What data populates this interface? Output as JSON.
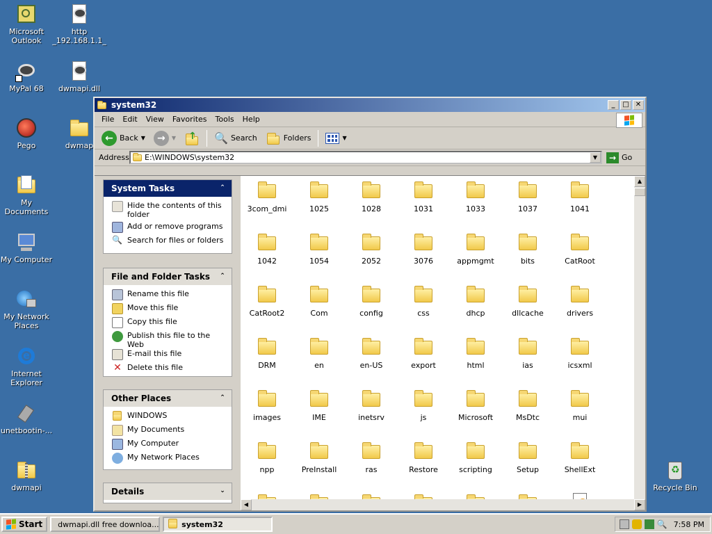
{
  "desktop": {
    "icons": [
      {
        "label": "Microsoft Outlook",
        "icon": "outlook-icon"
      },
      {
        "label": "http _192.168.1.1_",
        "icon": "raccoon-doc-icon"
      },
      {
        "label": "MyPal 68",
        "icon": "raccoon-shortcut-icon"
      },
      {
        "label": "dwmapi.dll",
        "icon": "raccoon-doc-icon"
      },
      {
        "label": "Pego",
        "icon": "red-orb-icon"
      },
      {
        "label": "dwmap",
        "icon": "folder-icon"
      },
      {
        "label": "My Documents",
        "icon": "my-documents-icon"
      },
      {
        "label": "My Computer",
        "icon": "my-computer-icon"
      },
      {
        "label": "My Network Places",
        "icon": "network-places-icon"
      },
      {
        "label": "Internet Explorer",
        "icon": "internet-explorer-icon"
      },
      {
        "label": "unetbootin-...",
        "icon": "unetbootin-icon"
      },
      {
        "label": "dwmapi",
        "icon": "zip-folder-icon"
      },
      {
        "label": "dwmap",
        "icon": "dll-gear-icon"
      },
      {
        "label": "Recycle Bin",
        "icon": "recycle-bin-icon"
      }
    ]
  },
  "window": {
    "title": "system32",
    "menu": [
      "File",
      "Edit",
      "View",
      "Favorites",
      "Tools",
      "Help"
    ],
    "toolbar": {
      "back": "Back",
      "search": "Search",
      "folders": "Folders"
    },
    "address": {
      "label": "Address",
      "value": "E:\\WINDOWS\\system32",
      "go": "Go"
    }
  },
  "tasks": {
    "system": {
      "title": "System Tasks",
      "items": [
        "Hide the contents of this folder",
        "Add or remove programs",
        "Search for files or folders"
      ]
    },
    "file_folder": {
      "title": "File and Folder Tasks",
      "items": [
        "Rename this file",
        "Move this file",
        "Copy this file",
        "Publish this file to the Web",
        "E-mail this file",
        "Delete this file"
      ]
    },
    "other_places": {
      "title": "Other Places",
      "items": [
        "WINDOWS",
        "My Documents",
        "My Computer",
        "My Network Places"
      ]
    },
    "details": {
      "title": "Details"
    }
  },
  "folders": [
    "3com_dmi",
    "1025",
    "1028",
    "1031",
    "1033",
    "1037",
    "1041",
    "1042",
    "1054",
    "2052",
    "3076",
    "appmgmt",
    "bits",
    "CatRoot",
    "CatRoot2",
    "Com",
    "config",
    "css",
    "dhcp",
    "dllcache",
    "drivers",
    "DRM",
    "en",
    "en-US",
    "export",
    "html",
    "ias",
    "icsxml",
    "images",
    "IME",
    "inetsrv",
    "js",
    "Microsoft",
    "MsDtc",
    "mui",
    "npp",
    "PreInstall",
    "ras",
    "Restore",
    "scripting",
    "Setup",
    "ShellExt"
  ],
  "taskbar": {
    "start": "Start",
    "buttons": [
      "dwmapi.dll free downloa...",
      "system32"
    ],
    "clock": "7:58 PM"
  }
}
